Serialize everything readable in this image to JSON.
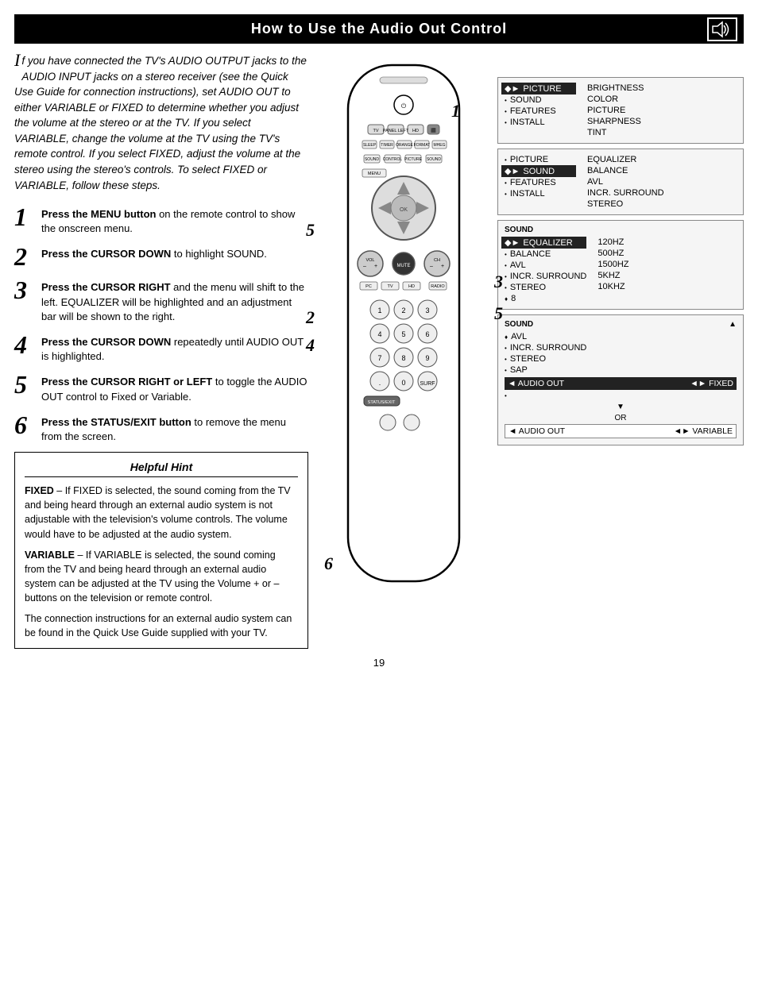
{
  "header": {
    "title": "How to Use the Audio Out Control",
    "icon": "speaker"
  },
  "intro": {
    "text": "If you have connected the TV's AUDIO OUTPUT jacks to the AUDIO INPUT jacks on a stereo receiver (see the Quick Use Guide for connection instructions), set AUDIO OUT to either VARIABLE or FIXED to determine whether you adjust the volume at the stereo or at the TV. If you select VARIABLE, change the volume at the TV using the TV's remote control. If you select FIXED, adjust the volume at the stereo using the stereo's controls. To select FIXED or VARIABLE, follow these steps."
  },
  "steps": [
    {
      "num": "1",
      "bold": "Press the MENU button",
      "rest": " on the remote control to show the onscreen menu."
    },
    {
      "num": "2",
      "bold": "Press the CURSOR DOWN",
      "rest": " to highlight SOUND."
    },
    {
      "num": "3",
      "bold": "Press the CURSOR RIGHT",
      "rest": " and the menu will shift to the left. EQUALIZER will be highlighted and an adjustment bar will be shown to the right."
    },
    {
      "num": "4",
      "bold": "Press the CURSOR DOWN",
      "rest": " repeatedly until AUDIO OUT is highlighted."
    },
    {
      "num": "5",
      "bold": "Press the CURSOR RIGHT or LEFT",
      "rest": " to toggle the AUDIO OUT control to Fixed or Variable."
    },
    {
      "num": "6",
      "bold": "Press the STATUS/EXIT button",
      "rest": " to remove the menu from the screen."
    }
  ],
  "hint": {
    "title": "Helpful Hint",
    "paragraphs": [
      "FIXED – If FIXED is selected, the sound coming from the TV and being heard through an external audio system is not adjustable with the television's volume controls. The volume would have to be adjusted at the audio system.",
      "VARIABLE – If VARIABLE is selected, the sound coming from the TV and being heard through an external audio system can be adjusted at the TV using the Volume + or – buttons on the television or remote control.",
      "The connection instructions for an external audio system can be found in the Quick Use Guide supplied with your TV."
    ]
  },
  "menus": {
    "menu1": {
      "label": "",
      "left_items": [
        {
          "bullet": "◆",
          "text": "PICTURE",
          "highlighted": true
        },
        {
          "bullet": "•",
          "text": "SOUND",
          "highlighted": false
        },
        {
          "bullet": "•",
          "text": "FEATURES",
          "highlighted": false
        },
        {
          "bullet": "•",
          "text": "INSTALL",
          "highlighted": false
        }
      ],
      "right_items": [
        {
          "text": "BRIGHTNESS"
        },
        {
          "text": "COLOR"
        },
        {
          "text": "PICTURE"
        },
        {
          "text": "SHARPNESS"
        },
        {
          "text": "TINT"
        }
      ]
    },
    "menu2": {
      "label": "",
      "left_items": [
        {
          "bullet": "•",
          "text": "PICTURE",
          "highlighted": false
        },
        {
          "bullet": "◆",
          "text": "SOUND",
          "highlighted": true
        },
        {
          "bullet": "•",
          "text": "FEATURES",
          "highlighted": false
        },
        {
          "bullet": "•",
          "text": "INSTALL",
          "highlighted": false
        }
      ],
      "right_items": [
        {
          "text": "EQUALIZER"
        },
        {
          "text": "BALANCE"
        },
        {
          "text": "AVL"
        },
        {
          "text": "INCR. SURROUND"
        },
        {
          "text": "STEREO"
        }
      ]
    },
    "menu3": {
      "label": "SOUND",
      "left_items": [
        {
          "bullet": "◆",
          "text": "EQUALIZER",
          "highlighted": true
        },
        {
          "bullet": "•",
          "text": "BALANCE",
          "highlighted": false
        },
        {
          "bullet": "•",
          "text": "AVL",
          "highlighted": false
        },
        {
          "bullet": "•",
          "text": "INCR. SURROUND",
          "highlighted": false
        },
        {
          "bullet": "•",
          "text": "STEREO",
          "highlighted": false
        },
        {
          "bullet": "♦",
          "text": "8",
          "highlighted": false
        }
      ],
      "right_items": [
        {
          "text": "120HZ"
        },
        {
          "text": "500HZ"
        },
        {
          "text": "1500HZ"
        },
        {
          "text": "5KHZ"
        },
        {
          "text": "10KHZ"
        }
      ]
    },
    "menu4": {
      "label": "SOUND",
      "items": [
        {
          "bullet": "♦",
          "text": "AVL",
          "highlighted": false
        },
        {
          "bullet": "•",
          "text": "INCR. SURROUND",
          "highlighted": false
        },
        {
          "bullet": "•",
          "text": "STEREO",
          "highlighted": false
        },
        {
          "bullet": "•",
          "text": "SAP",
          "highlighted": false
        },
        {
          "text": "AUDIO OUT",
          "value": "►FIXED",
          "highlighted": true,
          "isAudioOut": true
        },
        {
          "bullet": "•",
          "text": "",
          "highlighted": false
        }
      ],
      "or_row": true,
      "menu4b_row": {
        "text": "AUDIO OUT",
        "value": "◄► VARIABLE"
      }
    }
  },
  "step_labels": [
    "1",
    "5",
    "2",
    "4",
    "3",
    "5",
    "6"
  ],
  "page_number": "19"
}
